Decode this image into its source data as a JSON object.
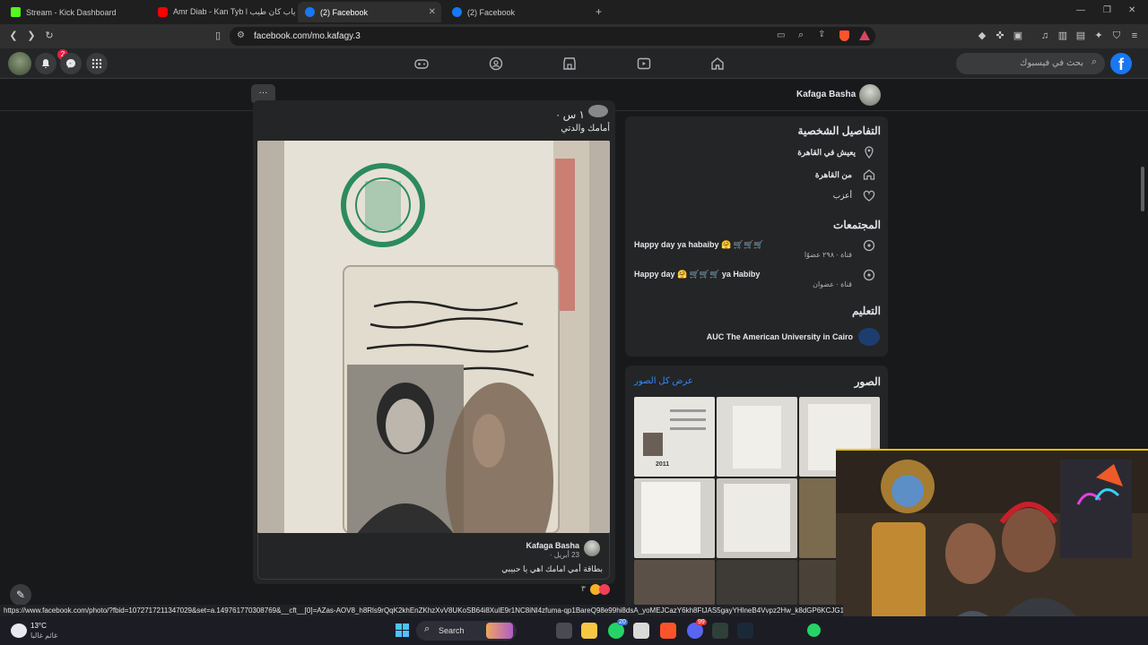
{
  "browser": {
    "tabs": [
      {
        "label": "Stream - Kick Dashboard"
      },
      {
        "label": "Amr Diab - Kan Tyb l دياب كان طيب"
      },
      {
        "label": "(2) Facebook"
      },
      {
        "label": "(2) Facebook"
      }
    ],
    "url": "facebook.com/mo.kafagy.3",
    "new_tab": "+"
  },
  "fb": {
    "notif_count": "2",
    "search_placeholder": "بحث في فيسبوك",
    "logo": "f",
    "profile_name": "Kafaga Basha",
    "more_dots": "···"
  },
  "post": {
    "time": "١ س ·",
    "caption": "أمامك والدتي",
    "comment": {
      "author": "Kafaga Basha",
      "date": "23 أبريل ·",
      "text": "بطاقة أمي امامك اهي يا حبيبي"
    },
    "reactions_count": "٣"
  },
  "details": {
    "title": "التفاصيل الشخصية",
    "lives_in": "يعيش في القاهرة",
    "from": "من القاهرة",
    "status": "أعزب",
    "communities_title": "المجتمعات",
    "communities": [
      {
        "name": "Happy day ya habaiby 🤗 🛒🛒🛒",
        "meta": "قناة · ٢٩٨ عضوًا"
      },
      {
        "name": "Happy day 🤗 🛒🛒🛒 ya Habiby",
        "meta": "قناة · عضوان"
      }
    ],
    "education_title": "التعليم",
    "education": "AUC The American University in Cairo"
  },
  "photos": {
    "title": "الصور",
    "see_all": "عرض كل الصور",
    "first_thumb_year": "2011"
  },
  "statusbar": {
    "link": "https://www.facebook.com/photo/?fbid=1072717211347029&set=a.149761770308769&__cft__[0]=AZas-AOV8_h8Rls9rQqK2khEnZKhzXvV8UKoSB64i8XulE9r1NC8iNl4zfuma-qp1BareQ98e99hi8dsA_yoMEJCazY6kh8FtJAS5gayYHlneB4Vvpz2Hw_k8dGP6KCJG1A-2bE"
  },
  "taskbar": {
    "temp": "13°C",
    "weather_text": "غائم غالبا",
    "search_label": "Search",
    "badge_1": "20",
    "badge_2": "99"
  },
  "colors": {
    "fb_blue": "#1877f2",
    "card_bg": "#242526",
    "page_bg": "#18191a",
    "link_blue": "#2d88ff"
  }
}
